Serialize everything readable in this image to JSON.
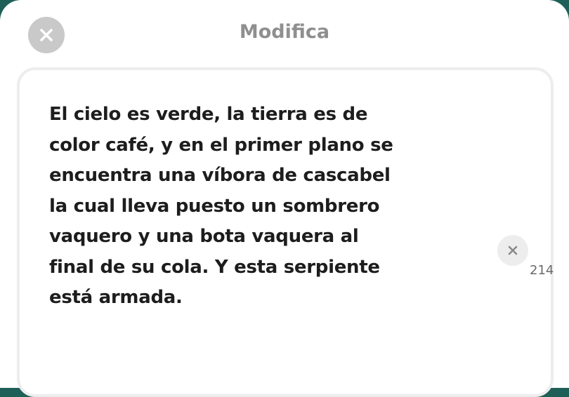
{
  "header": {
    "title": "Modifica",
    "close_icon": "close-icon"
  },
  "editor": {
    "text": "El cielo es verde, la tierra es de\ncolor café, y en el primer plano se\nencuentra una víbora de cascabel\nla cual lleva puesto un sombrero\nvaquero y una bota vaquera al\nfinal de su cola. Y esta serpiente\nestá armada.",
    "char_count": "214",
    "clear_icon": "clear-icon"
  },
  "colors": {
    "background": "#1e5f57",
    "close_button": "#c9c9c9",
    "title": "#8f8f8f",
    "text": "#1d1d1d"
  }
}
